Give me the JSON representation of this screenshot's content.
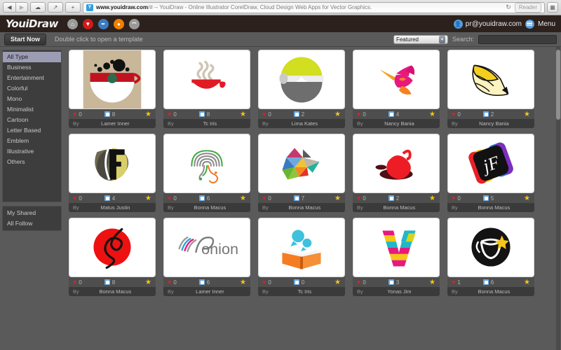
{
  "browser": {
    "back_icon": "back-arrow-icon",
    "forward_icon": "forward-arrow-icon",
    "cloud_icon": "cloud-icon",
    "share_icon": "share-icon",
    "plus_icon": "plus-icon",
    "favicon_letter": "Y",
    "url_bold": "www.youidraw.com",
    "url_rest": "/# -- YouiDraw - Online Illustrator CorelDraw, Cloud Design Web Apps for Vector Graphics.",
    "reload_icon": "reload-icon",
    "reader_label": "Reader",
    "tabs_icon": "show-tabs-icon"
  },
  "header": {
    "logo": "YouiDraw",
    "icons": [
      {
        "name": "home-icon",
        "glyph": "⌂",
        "bg": "#9a9a9a"
      },
      {
        "name": "logo-maker-icon",
        "glyph": "▼",
        "bg": "#d11a1a"
      },
      {
        "name": "drawing-icon",
        "glyph": "✒",
        "bg": "#3b7bbf"
      },
      {
        "name": "painter-icon",
        "glyph": "●",
        "bg": "#f08000"
      },
      {
        "name": "more-icon",
        "glyph": "•••",
        "bg": "#9a9a9a"
      }
    ],
    "user_email": "pr@youidraw.com",
    "user_icon": "user-avatar-icon",
    "menu_label": "Menu",
    "menu_icon": "hamburger-menu-icon"
  },
  "toolbar": {
    "start_now_label": "Start Now",
    "hint_text": "Double click to open a template",
    "sort_selected": "Featured",
    "sort_options": [
      "Featured"
    ],
    "search_label": "Search:",
    "search_value": "",
    "search_placeholder": ""
  },
  "sidebar": {
    "types": [
      {
        "label": "All Type",
        "active": true
      },
      {
        "label": "Business",
        "active": false
      },
      {
        "label": "Entertainment",
        "active": false
      },
      {
        "label": "Colorful",
        "active": false
      },
      {
        "label": "Mono",
        "active": false
      },
      {
        "label": "Minimalist",
        "active": false
      },
      {
        "label": "Cartoon",
        "active": false
      },
      {
        "label": "Letter Based",
        "active": false
      },
      {
        "label": "Emblem",
        "active": false
      },
      {
        "label": "Illustrative",
        "active": false
      },
      {
        "label": "Others",
        "active": false
      }
    ],
    "groups": [
      {
        "label": "My Shared"
      },
      {
        "label": "All Follow"
      }
    ]
  },
  "gallery": {
    "by_label": "By",
    "cards": [
      {
        "art": "coffee-cup-beans",
        "likes": "0",
        "copies": "8",
        "author": "Lamer Inner"
      },
      {
        "art": "red-cup-steam",
        "likes": "0",
        "copies": "8",
        "author": "Tc Iris"
      },
      {
        "art": "circle-bands",
        "likes": "0",
        "copies": "2",
        "author": "Lima Kates"
      },
      {
        "art": "hummingbird",
        "likes": "0",
        "copies": "4",
        "author": "Nancy Bania"
      },
      {
        "art": "pencil-wing",
        "likes": "0",
        "copies": "2",
        "author": "Nancy Bania"
      },
      {
        "art": "letter-f-shield",
        "likes": "0",
        "copies": "4",
        "author": "Matus Justin"
      },
      {
        "art": "brain-maze",
        "likes": "0",
        "copies": "6",
        "author": "Bonna Macus"
      },
      {
        "art": "triangle-mosaic",
        "likes": "0",
        "copies": "7",
        "author": "Bonna Macus"
      },
      {
        "art": "red-kettle",
        "likes": "0",
        "copies": "2",
        "author": "Bonna Macus"
      },
      {
        "art": "jf-splash",
        "likes": "0",
        "copies": "5",
        "author": "Bonna Macus"
      },
      {
        "art": "red-spiral",
        "likes": "0",
        "copies": "8",
        "author": "Bonna Macus"
      },
      {
        "art": "onion-wordmark",
        "likes": "0",
        "copies": "6",
        "author": "Lamer Inner"
      },
      {
        "art": "book-people",
        "likes": "0",
        "copies": "0",
        "author": "Tc Iris"
      },
      {
        "art": "striped-v",
        "likes": "0",
        "copies": "3",
        "author": "Yonas Jim"
      },
      {
        "art": "black-cup-star",
        "likes": "1",
        "copies": "6",
        "author": "Bonna Macus"
      }
    ]
  }
}
